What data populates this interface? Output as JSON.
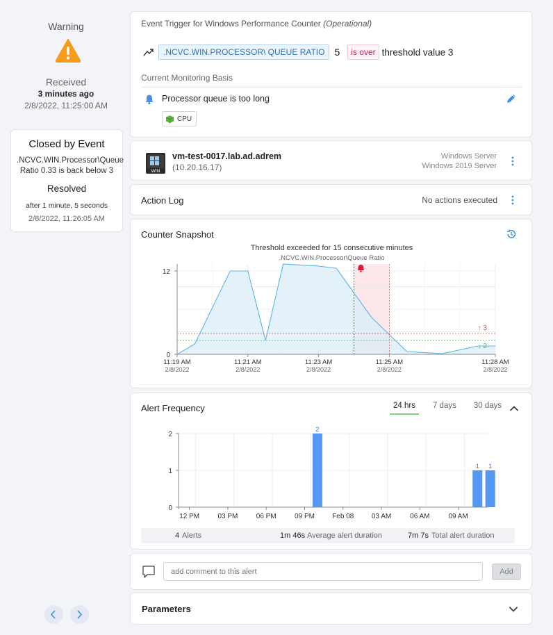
{
  "sidebar": {
    "severity": "Warning",
    "received_label": "Received",
    "received_ago": "3 minutes ago",
    "received_time": "2/8/2022, 11:25:00 AM",
    "closed_card": {
      "title": "Closed by Event",
      "description": ".NCVC.WIN.Processor\\Queue Ratio 0.33 is back below 3",
      "status": "Resolved",
      "after": "after 1 minute, 5 seconds",
      "time": "2/8/2022, 11:26:05 AM"
    },
    "nav": {
      "prev_icon": "chevron-left-icon",
      "next_icon": "chevron-right-icon"
    }
  },
  "event": {
    "title": "Event Trigger for Windows Performance Counter",
    "title_state": "(Operational)",
    "metric": ".NCVC.WIN.PROCESSOR\\ QUEUE RATIO",
    "value": "5",
    "condition": "is over",
    "threshold_text": "threshold value 3",
    "basis_label": "Current Monitoring Basis",
    "basis_item": "Processor queue is too long",
    "tag": "CPU",
    "colors": {
      "accent": "#3b8ee0",
      "metric_bg": "#ebf4fb",
      "over_text": "#c0205e",
      "warning": "#f59c1a"
    }
  },
  "device": {
    "name": "vm-test-0017.lab.ad.adrem",
    "ip": "(10.20.16.17)",
    "os_line1": "Windows Server",
    "os_line2": "Windows 2019 Server",
    "icon": "windows-server-icon",
    "icon_text": "WIN"
  },
  "action_log": {
    "title": "Action Log",
    "status": "No actions executed"
  },
  "snapshot": {
    "title": "Counter Snapshot",
    "chart_data": {
      "type": "area",
      "title": "Threshold exceeded for 15 consecutive minutes",
      "subtitle": ".NCVC.WIN.Processor\\Queue Ratio",
      "x": [
        "11:19",
        "11:19:30",
        "11:20:30",
        "11:21",
        "11:21:30",
        "11:22",
        "11:23",
        "11:23:30",
        "11:24:30",
        "11:25:30",
        "11:26:30",
        "11:27:30",
        "11:28"
      ],
      "y": [
        0,
        1.5,
        12,
        12,
        2,
        13,
        12.7,
        12.4,
        5.3,
        0.4,
        0.1,
        1.2,
        1.2
      ],
      "ylim": [
        0,
        13
      ],
      "y_ticks": [
        0,
        12
      ],
      "x_ticks": [
        {
          "label": "11:19 AM",
          "date": "2/8/2022"
        },
        {
          "label": "11:21 AM",
          "date": "2/8/2022"
        },
        {
          "label": "11:23 AM",
          "date": "2/8/2022"
        },
        {
          "label": "11:25 AM",
          "date": "2/8/2022"
        },
        {
          "label": "11:28 AM",
          "date": "2/8/2022"
        }
      ],
      "thresholds": [
        {
          "label": "3",
          "value": 3,
          "direction": "up",
          "color": "#d9534f"
        },
        {
          "label": "2",
          "value": 2,
          "direction": "down",
          "color": "#5cb85c"
        }
      ],
      "alert_window": {
        "start": "11:24",
        "end": "11:25",
        "color": "#fbe7ea"
      },
      "colors": {
        "line": "#5bb5e6",
        "fill": "#dcedf8"
      }
    }
  },
  "frequency": {
    "title": "Alert Frequency",
    "tabs": [
      {
        "label": "24 hrs",
        "active": true
      },
      {
        "label": "7 days",
        "active": false
      },
      {
        "label": "30 days",
        "active": false
      }
    ],
    "chart_data": {
      "type": "bar",
      "x_ticks": [
        "12 PM",
        "03 PM",
        "06 PM",
        "09 PM",
        "Feb 08",
        "03 AM",
        "06 AM",
        "09 AM"
      ],
      "ylim": [
        0,
        2
      ],
      "y_ticks": [
        0,
        1,
        2
      ],
      "bars": [
        {
          "at": "10 PM",
          "value": 2,
          "label": "2"
        },
        {
          "at": "10:30 AM",
          "value": 1,
          "label": "1"
        },
        {
          "at": "11:30 AM",
          "value": 1,
          "label": "1"
        }
      ],
      "color": "#5598f4"
    },
    "stats": {
      "alerts_num": "4",
      "alerts_label": "Alerts",
      "avg_num": "1m 46s",
      "avg_label": "Average alert duration",
      "total_num": "7m 7s",
      "total_label": "Total alert duration"
    }
  },
  "comment": {
    "placeholder": "add comment to this alert",
    "add_label": "Add"
  },
  "parameters": {
    "title": "Parameters"
  }
}
